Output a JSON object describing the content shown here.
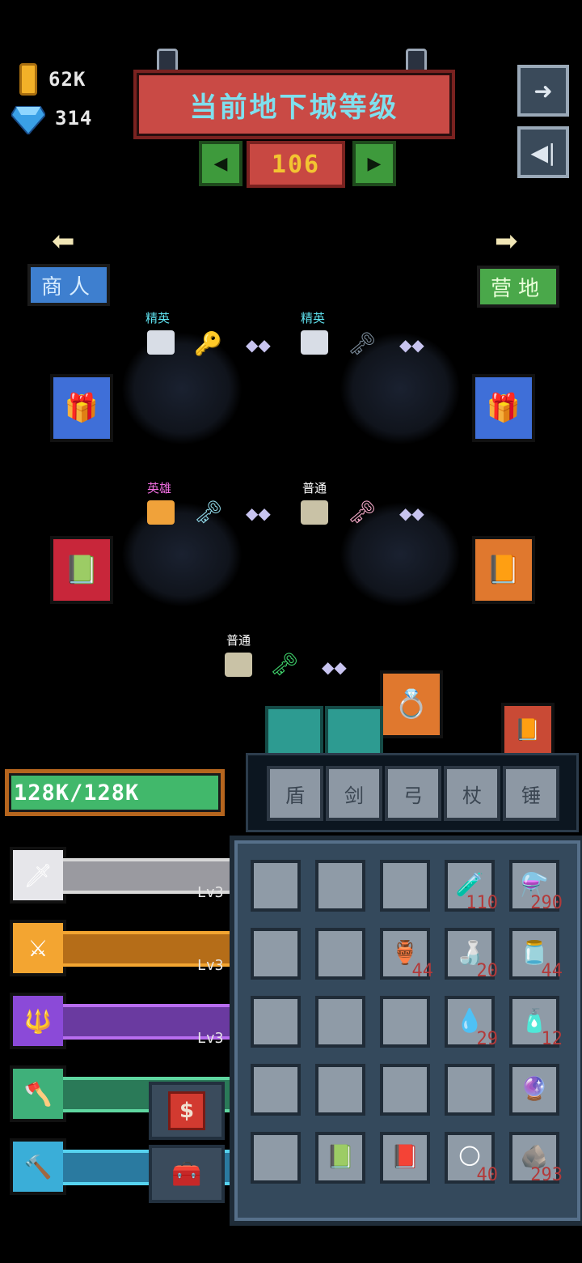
{
  "currency": {
    "gold": "62K",
    "gems": "314"
  },
  "header": {
    "title": "当前地下城等级",
    "level": "106"
  },
  "nav": {
    "merchant": "商人",
    "camp": "营地"
  },
  "enemies": [
    {
      "tier": "精英",
      "tier_color": "#5fe3f0"
    },
    {
      "tier": "精英",
      "tier_color": "#5fe3f0"
    },
    {
      "tier": "英雄",
      "tier_color": "#f06ee0"
    },
    {
      "tier": "普通",
      "tier_color": "#ffffff"
    },
    {
      "tier": "普通",
      "tier_color": "#ffffff"
    }
  ],
  "player": {
    "hp": "128K/128K"
  },
  "skills": [
    {
      "level": "Lv3",
      "icon": "gem-blade-icon",
      "color": "#e8e8e8"
    },
    {
      "level": "Lv3",
      "icon": "crossed-swords-icon",
      "color": "#f3a531"
    },
    {
      "level": "Lv3",
      "icon": "trident-icon",
      "color": "#b86df0"
    },
    {
      "level": "",
      "icon": "axe-icon",
      "color": "#5fd6a0"
    },
    {
      "level": "",
      "icon": "mace-icon",
      "color": "#56d3f0"
    }
  ],
  "categories": [
    "盾",
    "剑",
    "弓",
    "杖",
    "锤"
  ],
  "inventory": [
    [
      {
        "icon": "",
        "count": ""
      },
      {
        "icon": "",
        "count": ""
      },
      {
        "icon": "",
        "count": ""
      },
      {
        "icon": "🧪",
        "count": "110"
      },
      {
        "icon": "⚗️",
        "count": "290"
      }
    ],
    [
      {
        "icon": "",
        "count": ""
      },
      {
        "icon": "",
        "count": ""
      },
      {
        "icon": "🏺",
        "count": "44"
      },
      {
        "icon": "🍶",
        "count": "20"
      },
      {
        "icon": "🫙",
        "count": "44"
      }
    ],
    [
      {
        "icon": "",
        "count": ""
      },
      {
        "icon": "",
        "count": ""
      },
      {
        "icon": "",
        "count": ""
      },
      {
        "icon": "💧",
        "count": "29"
      },
      {
        "icon": "🧴",
        "count": "12"
      }
    ],
    [
      {
        "icon": "",
        "count": ""
      },
      {
        "icon": "",
        "count": ""
      },
      {
        "icon": "",
        "count": ""
      },
      {
        "icon": "",
        "count": ""
      },
      {
        "icon": "🔮",
        "count": ""
      }
    ],
    [
      {
        "icon": "",
        "count": ""
      },
      {
        "icon": "📗",
        "count": ""
      },
      {
        "icon": "📕",
        "count": ""
      },
      {
        "icon": "🌕",
        "count": "40"
      },
      {
        "icon": "🪨",
        "count": "293"
      }
    ]
  ],
  "shop": {
    "money_icon": "$"
  }
}
